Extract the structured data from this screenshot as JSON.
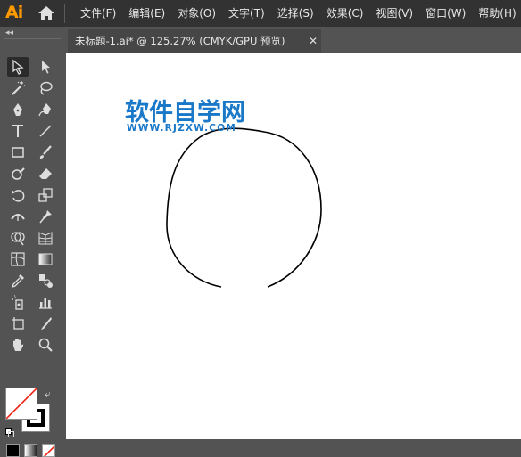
{
  "app": {
    "logo": "Ai"
  },
  "menu": [
    "文件(F)",
    "编辑(E)",
    "对象(O)",
    "文字(T)",
    "选择(S)",
    "效果(C)",
    "视图(V)",
    "窗口(W)",
    "帮助(H)"
  ],
  "toolbar": {
    "collapse_label": "◂◂"
  },
  "document_tab": {
    "title": "未标题-1.ai* @ 125.27% (CMYK/GPU 预览)",
    "close": "✕"
  },
  "watermark": {
    "name": "软件自学网",
    "url": "WWW.RJZXW.COM"
  },
  "colors": {
    "accent_logo": "#ff9a00",
    "watermark": "#1a78c8",
    "menubar": "#323232",
    "panel": "#535353"
  },
  "tools": [
    [
      "selection-tool-icon",
      "direct-selection-tool-icon"
    ],
    [
      "magic-wand-tool-icon",
      "lasso-tool-icon"
    ],
    [
      "pen-tool-icon",
      "curvature-tool-icon"
    ],
    [
      "type-tool-icon",
      "line-segment-tool-icon"
    ],
    [
      "rectangle-tool-icon",
      "paintbrush-tool-icon"
    ],
    [
      "shaper-tool-icon",
      "eraser-tool-icon"
    ],
    [
      "rotate-tool-icon",
      "scale-tool-icon"
    ],
    [
      "width-tool-icon",
      "puppet-warp-tool-icon"
    ],
    [
      "shape-builder-tool-icon",
      "perspective-grid-tool-icon"
    ],
    [
      "mesh-tool-icon",
      "gradient-tool-icon"
    ],
    [
      "eyedropper-tool-icon",
      "blend-tool-icon"
    ],
    [
      "symbol-sprayer-tool-icon",
      "column-graph-tool-icon"
    ],
    [
      "artboard-tool-icon",
      "slice-tool-icon"
    ],
    [
      "hand-tool-icon",
      "zoom-tool-icon"
    ]
  ]
}
